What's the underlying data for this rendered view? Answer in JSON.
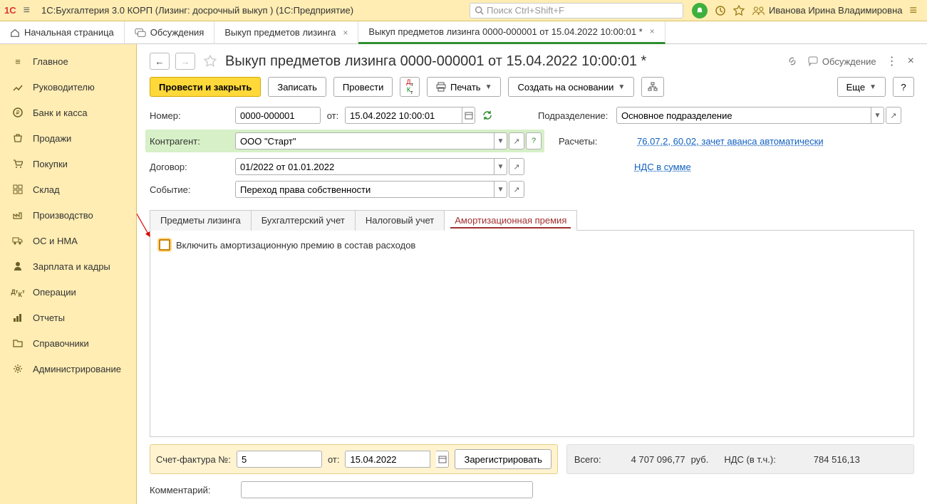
{
  "titlebar": {
    "app_title": "1С:Бухгалтерия 3.0 КОРП (Лизинг: досрочный выкуп )  (1С:Предприятие)",
    "search_placeholder": "Поиск Ctrl+Shift+F",
    "user_name": "Иванова Ирина Владимировна"
  },
  "tabs": [
    {
      "label": "Начальная страница"
    },
    {
      "label": "Обсуждения"
    },
    {
      "label": "Выкуп предметов лизинга",
      "closable": true
    },
    {
      "label": "Выкуп предметов лизинга 0000-000001 от 15.04.2022 10:00:01 *",
      "closable": true,
      "active": true
    }
  ],
  "sidebar": {
    "items": [
      "Главное",
      "Руководителю",
      "Банк и касса",
      "Продажи",
      "Покупки",
      "Склад",
      "Производство",
      "ОС и НМА",
      "Зарплата и кадры",
      "Операции",
      "Отчеты",
      "Справочники",
      "Администрирование"
    ]
  },
  "page": {
    "title": "Выкуп предметов лизинга 0000-000001 от 15.04.2022 10:00:01 *",
    "discussion": "Обсуждение",
    "toolbar": {
      "post_close": "Провести и закрыть",
      "write": "Записать",
      "post": "Провести",
      "print": "Печать",
      "create_based": "Создать на основании",
      "more": "Еще",
      "help": "?"
    },
    "form": {
      "number_label": "Номер:",
      "number_value": "0000-000001",
      "from_label": "от:",
      "date_value": "15.04.2022 10:00:01",
      "division_label": "Подразделение:",
      "division_value": "Основное подразделение",
      "counterparty_label": "Контрагент:",
      "counterparty_value": "ООО \"Старт\"",
      "settlements_label": "Расчеты:",
      "settlements_link": "76.07.2, 60.02, зачет аванса автоматически",
      "contract_label": "Договор:",
      "contract_value": "01/2022 от 01.01.2022",
      "nds_link": "НДС в сумме",
      "event_label": "Событие:",
      "event_value": "Переход права собственности"
    },
    "inner_tabs": [
      "Предметы лизинга",
      "Бухгалтерский учет",
      "Налоговый учет",
      "Амортизационная премия"
    ],
    "inner_active": 3,
    "checkbox_label": "Включить амортизационную премию в состав расходов",
    "footer": {
      "invoice_no_label": "Счет-фактура №:",
      "invoice_no_value": "5",
      "invoice_from_label": "от:",
      "invoice_date_value": "15.04.2022",
      "register_btn": "Зарегистрировать",
      "total_label": "Всего:",
      "total_value": "4 707 096,77",
      "currency": "руб.",
      "nds_label": "НДС (в т.ч.):",
      "nds_value": "784 516,13",
      "comment_label": "Комментарий:"
    }
  }
}
